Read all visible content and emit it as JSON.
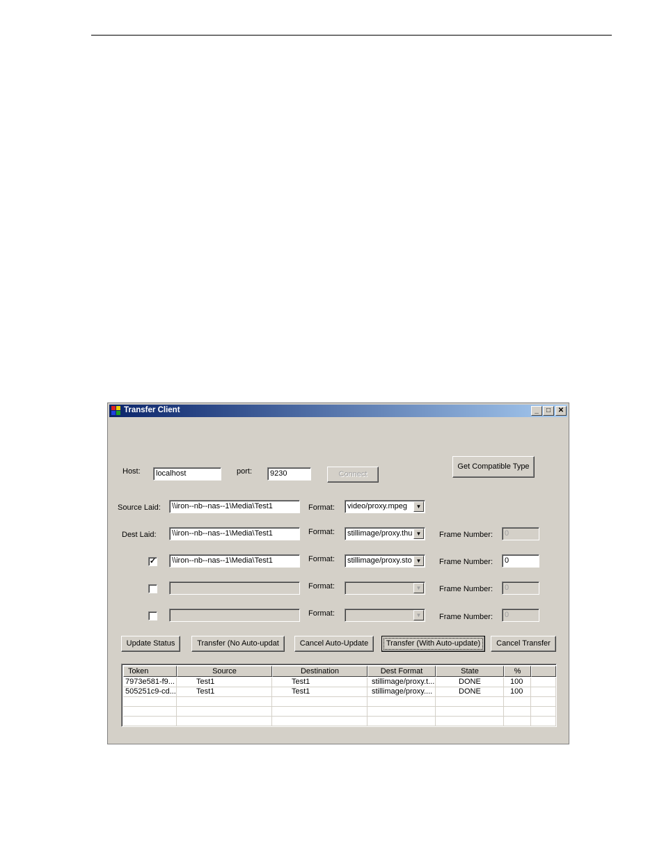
{
  "window": {
    "title": "Transfer Client",
    "minimize": "_",
    "maximize": "□",
    "close": "✕"
  },
  "connection": {
    "host_label": "Host:",
    "host_value": "localhost",
    "port_label": "port:",
    "port_value": "9230",
    "connect_label": "Connect"
  },
  "compatible_button": "Get Compatible Type",
  "source": {
    "label": "Source Laid:",
    "value": "\\\\iron--nb--nas--1\\Media\\Test1",
    "format_label": "Format:",
    "format_value": "video/proxy.mpeg"
  },
  "dest_rows": [
    {
      "label": "Dest Laid:",
      "checked": null,
      "value": "\\\\iron--nb--nas--1\\Media\\Test1",
      "format_label": "Format:",
      "format_value": "stillimage/proxy.thum",
      "frame_label": "Frame Number:",
      "frame_value": "0"
    },
    {
      "label": "",
      "checked": "✓",
      "value": "\\\\iron--nb--nas--1\\Media\\Test1",
      "format_label": "Format:",
      "format_value": "stillimage/proxy.story",
      "frame_label": "Frame Number:",
      "frame_value": "0"
    },
    {
      "label": "",
      "checked": "",
      "value": "",
      "format_label": "Format:",
      "format_value": "",
      "frame_label": "Frame Number:",
      "frame_value": "0"
    },
    {
      "label": "",
      "checked": "",
      "value": "",
      "format_label": "Format:",
      "format_value": "",
      "frame_label": "Frame Number:",
      "frame_value": "0"
    }
  ],
  "actions": {
    "update_status": "Update Status",
    "transfer_no_auto": "Transfer  (No  Auto-updat",
    "cancel_auto": "Cancel Auto-Update",
    "transfer_auto": "Transfer (With Auto-update)",
    "cancel_transfer": "Cancel Transfer"
  },
  "table": {
    "columns": [
      "Token",
      "Source",
      "Destination",
      "Dest Format",
      "State",
      "%",
      ""
    ],
    "rows": [
      [
        "7973e581-f9...",
        "Test1",
        "Test1",
        "stillimage/proxy.t...",
        "DONE",
        "100",
        ""
      ],
      [
        "505251c9-cd...",
        "Test1",
        "Test1",
        "stillimage/proxy....",
        "DONE",
        "100",
        ""
      ],
      [
        "",
        "",
        "",
        "",
        "",
        "",
        ""
      ],
      [
        "",
        "",
        "",
        "",
        "",
        "",
        ""
      ],
      [
        "",
        "",
        "",
        "",
        "",
        "",
        ""
      ]
    ]
  },
  "colors": {
    "titlebar_start": "#0a246a",
    "titlebar_end": "#a6caf0",
    "window_bg": "#d4d0c8"
  },
  "icons": {
    "app": "app-window-icon",
    "combo_arrow": "▼"
  }
}
